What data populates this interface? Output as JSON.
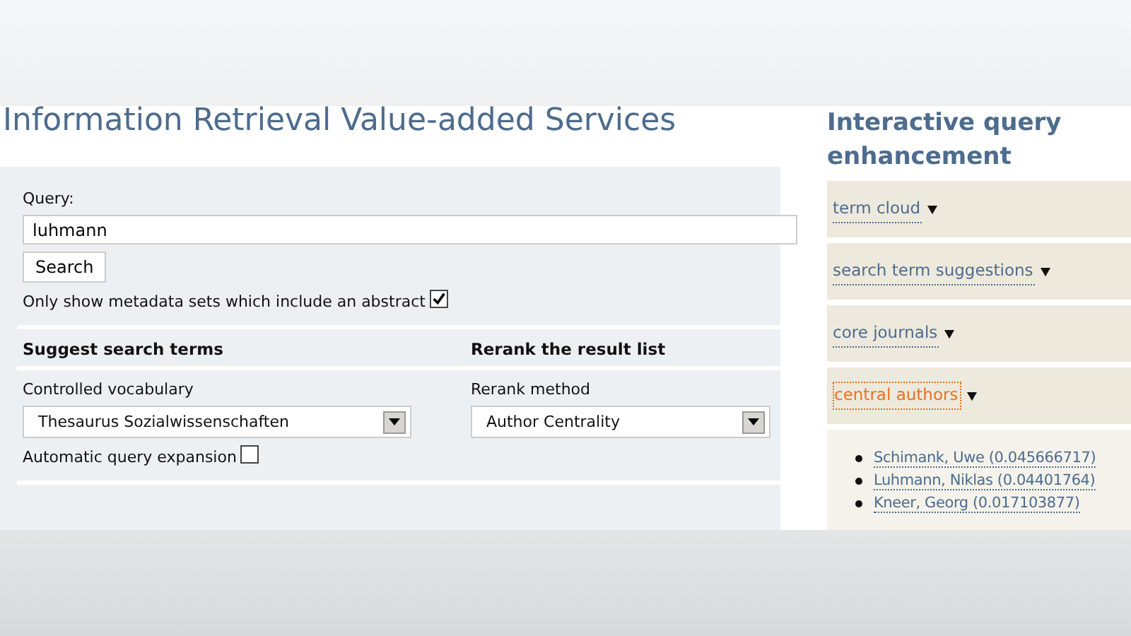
{
  "title": "Information Retrieval Value-added Services",
  "query": {
    "label": "Query:",
    "value": "luhmann",
    "button": "Search",
    "abstract_option": {
      "label": "Only show metadata sets which include an abstract",
      "checked": true
    }
  },
  "suggest": {
    "heading": "Suggest search terms",
    "vocabulary_label": "Controlled vocabulary",
    "vocabulary_value": "Thesaurus Sozialwissenschaften",
    "expansion": {
      "label": "Automatic query expansion",
      "checked": false
    }
  },
  "rerank": {
    "heading": "Rerank the result list",
    "method_label": "Rerank method",
    "method_value": "Author Centrality"
  },
  "sidebar": {
    "title": "Interactive query enhancement",
    "sections": [
      {
        "label": "term cloud",
        "selected": false
      },
      {
        "label": "search term suggestions",
        "selected": false
      },
      {
        "label": "core journals",
        "selected": false
      },
      {
        "label": "central authors",
        "selected": true,
        "items": [
          "Schimank, Uwe (0.045666717)",
          "Luhmann, Niklas (0.04401764)",
          "Kneer, Georg (0.017103877)"
        ]
      }
    ]
  }
}
